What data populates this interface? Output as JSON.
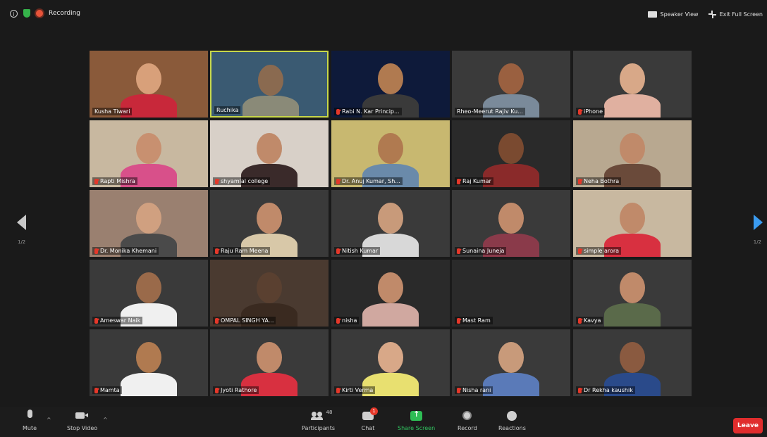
{
  "topbar": {
    "recording_label": "Recording",
    "speaker_view_label": "Speaker View",
    "exit_fullscreen_label": "Exit Full Screen"
  },
  "pagination": {
    "left": "1/2",
    "right": "1/2"
  },
  "participants": [
    {
      "name": "Kusha Tiwari",
      "muted": false,
      "bg": "#8a5a3a",
      "skin": "#d8a07a",
      "shirt": "#c8283a"
    },
    {
      "name": "Ruchika",
      "muted": false,
      "active": true,
      "bg": "#3a5a72",
      "skin": "#8a6a50",
      "shirt": "#8a8a78"
    },
    {
      "name": "Rabi N. Kar Princip...",
      "muted": true,
      "bg": "#0e1a3a",
      "skin": "#b07a50",
      "shirt": "#3a3a3a"
    },
    {
      "name": "Rheo-Meerut Rajiv Ku...",
      "muted": false,
      "bg": "#3a3a3a",
      "skin": "#9a6040",
      "shirt": "#7a8a9a"
    },
    {
      "name": "iPhone",
      "muted": true,
      "bg": "#3a3a3a",
      "skin": "#d8a888",
      "shirt": "#e0b0a0"
    },
    {
      "name": "Rapti Mishra",
      "muted": true,
      "bg": "#c8b8a0",
      "skin": "#c89070",
      "shirt": "#d8508a"
    },
    {
      "name": "shyamlal college",
      "muted": true,
      "bg": "#d8d0c8",
      "skin": "#c08a6a",
      "shirt": "#3a2a2a"
    },
    {
      "name": "Dr. Anuj Kumar, Sh...",
      "muted": true,
      "bg": "#c8b870",
      "skin": "#b07a50",
      "shirt": "#6a8aaa"
    },
    {
      "name": "Raj Kumar",
      "muted": true,
      "bg": "#2a2a2a",
      "skin": "#7a4a30",
      "shirt": "#8a2a2a"
    },
    {
      "name": "Neha Bothra",
      "muted": true,
      "bg": "#b8a890",
      "skin": "#c08a6a",
      "shirt": "#6a4a3a"
    },
    {
      "name": "Dr. Monika Khemani",
      "muted": true,
      "bg": "#9a8070",
      "skin": "#d0a080",
      "shirt": "#4a4a4a"
    },
    {
      "name": "Raju Ram Meena",
      "muted": true,
      "bg": "#3a3a3a",
      "skin": "#c08a6a",
      "shirt": "#d8c8a8"
    },
    {
      "name": "Nitish Kumar",
      "muted": true,
      "bg": "#3a3a3a",
      "skin": "#c89a7a",
      "shirt": "#d8d8d8"
    },
    {
      "name": "Sunaina Juneja",
      "muted": true,
      "bg": "#3a3a3a",
      "skin": "#c08a6a",
      "shirt": "#8a3a4a"
    },
    {
      "name": "simple arora",
      "muted": true,
      "bg": "#c8b8a0",
      "skin": "#c08a6a",
      "shirt": "#d83040"
    },
    {
      "name": "Ameswar Naik",
      "muted": true,
      "bg": "#3a3a3a",
      "skin": "#9a6a4a",
      "shirt": "#f0f0f0"
    },
    {
      "name": "OMPAL SINGH YA...",
      "muted": true,
      "bg": "#4a3a30",
      "skin": "#5a4030",
      "shirt": "#3a2a20"
    },
    {
      "name": "nisha",
      "muted": true,
      "bg": "#2a2a2a",
      "skin": "#c08a6a",
      "shirt": "#d0a8a0"
    },
    {
      "name": "Mast Ram",
      "muted": true,
      "bg": "#2a2a2a",
      "skin": "#2a2a2a",
      "shirt": "#2a2a2a"
    },
    {
      "name": "Kavya",
      "muted": true,
      "bg": "#3a3a3a",
      "skin": "#c08a6a",
      "shirt": "#5a6a4a"
    },
    {
      "name": "Mamta",
      "muted": true,
      "bg": "#3a3a3a",
      "skin": "#b07a50",
      "shirt": "#f0f0f0"
    },
    {
      "name": "Jyoti Rathore",
      "muted": true,
      "bg": "#3a3a3a",
      "skin": "#c08a6a",
      "shirt": "#d83040"
    },
    {
      "name": "Kirti Verma",
      "muted": true,
      "bg": "#3a3a3a",
      "skin": "#d8a888",
      "shirt": "#e8e070"
    },
    {
      "name": "Nisha rani",
      "muted": true,
      "bg": "#3a3a3a",
      "skin": "#c89a7a",
      "shirt": "#5a7ab8"
    },
    {
      "name": "Dr Rekha kaushik",
      "muted": true,
      "bg": "#3a3a3a",
      "skin": "#8a5a40",
      "shirt": "#2a4a8a"
    }
  ],
  "bottombar": {
    "mute_label": "Mute",
    "stop_video_label": "Stop Video",
    "participants_label": "Participants",
    "participants_count": "48",
    "chat_label": "Chat",
    "chat_badge": "1",
    "share_label": "Share Screen",
    "record_label": "Record",
    "reactions_label": "Reactions",
    "leave_label": "Leave"
  }
}
